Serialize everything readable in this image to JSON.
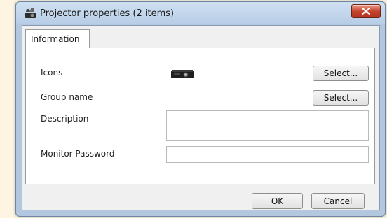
{
  "window": {
    "title": "Projector properties (2 items)"
  },
  "tabs": [
    {
      "label": "Information"
    }
  ],
  "form": {
    "icons_label": "Icons",
    "icons_button": "Select...",
    "group_label": "Group name",
    "group_button": "Select...",
    "description_label": "Description",
    "description_value": "",
    "password_label": "Monitor Password",
    "password_value": ""
  },
  "footer": {
    "ok_label": "OK",
    "cancel_label": "Cancel"
  },
  "icons": {
    "app": "projector-app-icon",
    "close": "close-icon",
    "projector": "projector-icon"
  },
  "colors": {
    "close_button": "#c3412b",
    "titlebar": "#cfe0f2"
  }
}
